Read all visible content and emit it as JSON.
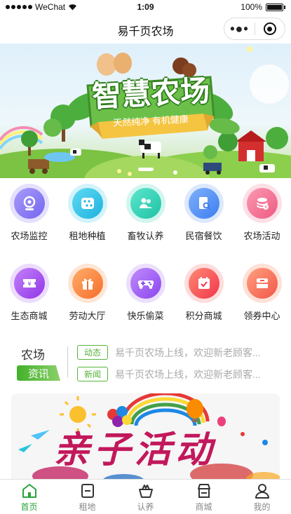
{
  "status_bar": {
    "carrier": "WeChat",
    "time": "1:09",
    "battery": "100%"
  },
  "nav": {
    "title": "易千页农场",
    "more_icon": "more-dots-icon",
    "close_icon": "target-close-icon"
  },
  "banner": {
    "title": "智慧农场",
    "slogan": "天然纯净 有机健康"
  },
  "menu": {
    "row1": [
      {
        "label": "农场监控",
        "icon": "camera-icon",
        "color": "#8e7cf6"
      },
      {
        "label": "租地种植",
        "icon": "plot-icon",
        "color": "#33c6e8"
      },
      {
        "label": "畜牧认养",
        "icon": "users-icon",
        "color": "#2fd3b7"
      },
      {
        "label": "民宿餐饮",
        "icon": "search-doc-icon",
        "color": "#4a8ef5"
      },
      {
        "label": "农场活动",
        "icon": "coin-stack-icon",
        "color": "#f2708f"
      }
    ],
    "row2": [
      {
        "label": "生态商城",
        "icon": "ticket-icon",
        "color": "#a94ef0"
      },
      {
        "label": "劳动大厅",
        "icon": "gift-icon",
        "color": "#fb8b3c"
      },
      {
        "label": "快乐偷菜",
        "icon": "gamepad-icon",
        "color": "#9c55f0"
      },
      {
        "label": "积分商城",
        "icon": "calendar-check-icon",
        "color": "#fb5a5d"
      },
      {
        "label": "领券中心",
        "icon": "coupon-icon",
        "color": "#fa7b5d"
      }
    ]
  },
  "news": {
    "brand_top": "农场",
    "brand_tag": "资讯",
    "items": [
      {
        "tag": "动态",
        "text": "易千页农场上线，欢迎新老顾客..."
      },
      {
        "tag": "新闻",
        "text": "易千页农场上线，欢迎新老顾客..."
      }
    ]
  },
  "activity": {
    "title": "亲子活动"
  },
  "tabs": [
    {
      "label": "首页",
      "icon": "home-icon",
      "active": true
    },
    {
      "label": "租地",
      "icon": "land-icon",
      "active": false
    },
    {
      "label": "认养",
      "icon": "basket-icon",
      "active": false
    },
    {
      "label": "商城",
      "icon": "shop-icon",
      "active": false
    },
    {
      "label": "我的",
      "icon": "user-icon",
      "active": false
    }
  ],
  "colors": {
    "accent": "#2ba43b",
    "tag_green": "#57b33a"
  }
}
